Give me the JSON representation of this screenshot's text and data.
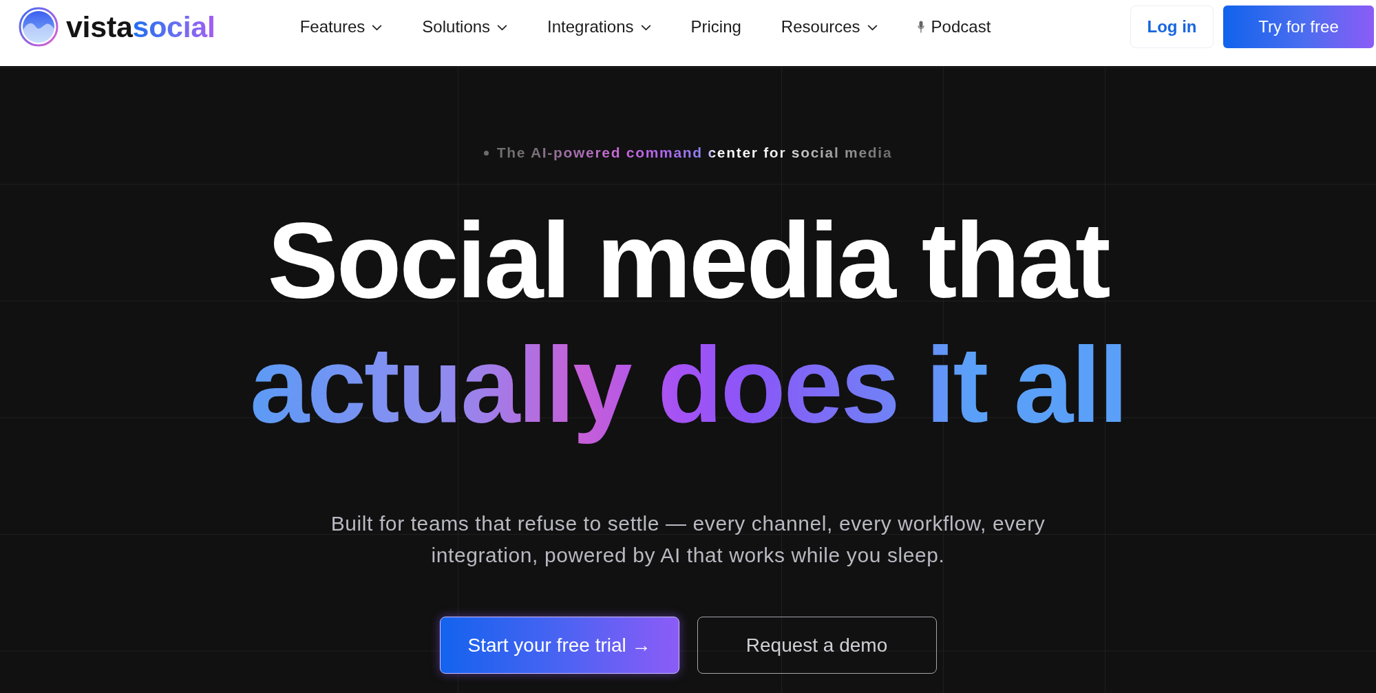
{
  "header": {
    "logo": {
      "name_start": "vista",
      "name_end": "social"
    },
    "nav": [
      {
        "label": "Features",
        "kind": "dropdown"
      },
      {
        "label": "Solutions",
        "kind": "dropdown"
      },
      {
        "label": "Integrations",
        "kind": "dropdown"
      },
      {
        "label": "Pricing",
        "kind": "plain"
      },
      {
        "label": "Resources",
        "kind": "dropdown"
      },
      {
        "label": "Podcast",
        "kind": "podcast"
      }
    ],
    "actions": [
      {
        "label": "Log in",
        "kind": "secondary"
      },
      {
        "label": "Try for free",
        "kind": "primary"
      }
    ]
  },
  "hero": {
    "eyebrow": "The AI-powered command center for social media",
    "headline_line_1": "Social media that",
    "headline_line_2": "actually does it all",
    "subtitle": "Built for teams that refuse to settle — every channel, every workflow, every integration, powered by AI that works while you sleep.",
    "buttons": [
      {
        "label": "Start your free trial →",
        "kind": "primary"
      },
      {
        "label": "Request a demo",
        "kind": "outline"
      }
    ]
  }
}
